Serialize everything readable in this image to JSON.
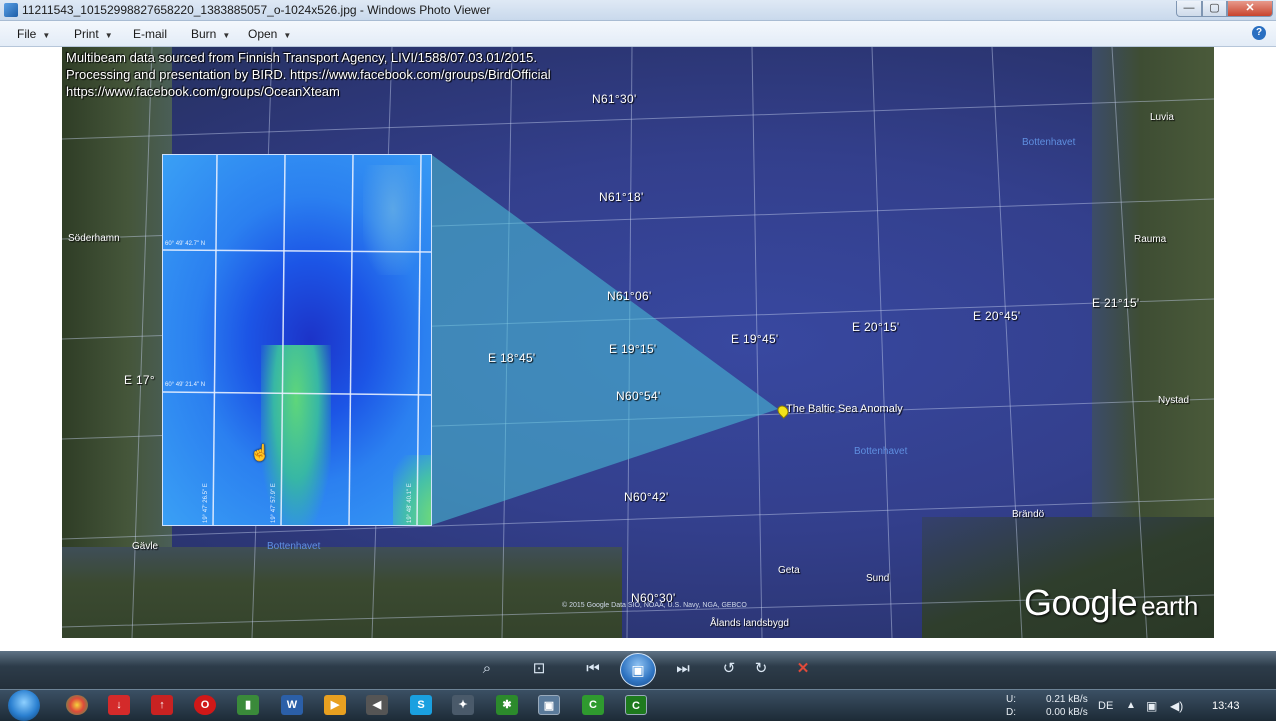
{
  "window": {
    "title": "11211543_10152998827658220_1383885057_o-1024x526.jpg - Windows Photo Viewer",
    "minimize": "—",
    "maximize": "▢",
    "close": "✕"
  },
  "menu": {
    "file": "File",
    "print": "Print",
    "email": "E-mail",
    "burn": "Burn",
    "open": "Open",
    "help": "?"
  },
  "image": {
    "info_lines": [
      "Multibeam data sourced from Finnish Transport Agency, LIVI/1588/07.03.01/2015.",
      "Processing and presentation by BIRD. https://www.facebook.com/groups/BirdOfficial",
      "https://www.facebook.com/groups/OceanXteam"
    ],
    "latitudes": [
      "N61°30'",
      "N61°18'",
      "N61°06'",
      "N60°54'",
      "N60°42'",
      "N60°30'"
    ],
    "longitudes": [
      "E 17°",
      "E 18°45'",
      "E 19°15'",
      "E 19°45'",
      "E 20°15'",
      "E 20°45'",
      "E 21°15'"
    ],
    "places": {
      "soderhamn": "Söderhamn",
      "gavle": "Gävle",
      "luvia": "Luvia",
      "rauma": "Rauma",
      "nystad": "Nystad",
      "brando": "Brändö",
      "geta": "Geta",
      "sund": "Sund",
      "alands": "Ålands landsbygd"
    },
    "sea_labels": {
      "bottenhavet_top": "Bottenhavet",
      "bottenhavet_mid": "Bottenhavet",
      "bottenhavet_left": "Bottenhavet"
    },
    "anomaly_label": "The Baltic Sea Anomaly",
    "inset_labels": {
      "lat_top": "60° 49' 42.7\" N",
      "lat_bottom": "60° 49' 21.4\" N",
      "lon_1": "19° 47' 26.5\" E",
      "lon_2": "19° 47' 57.9\" E",
      "lon_3": "19° 48' 40.1\" E"
    },
    "copyright": "© 2015 Google   Data SIO, NOAA, U.S. Navy, NGA, GEBCO",
    "brand_google": "Google",
    "brand_earth": "earth"
  },
  "controls": {
    "zoom": "⌕",
    "actual_size": "⊡",
    "previous": "⏮",
    "slideshow": "▣",
    "next": "⏭",
    "rotate_ccw": "↺",
    "rotate_cw": "↻",
    "delete": "✕"
  },
  "taskbar": {
    "tray_up_label": "U:",
    "tray_down_label": "D:",
    "up_speed": "0.21 kB/s",
    "down_speed": "0.00 kB/s",
    "language": "DE",
    "time": "13:43"
  }
}
